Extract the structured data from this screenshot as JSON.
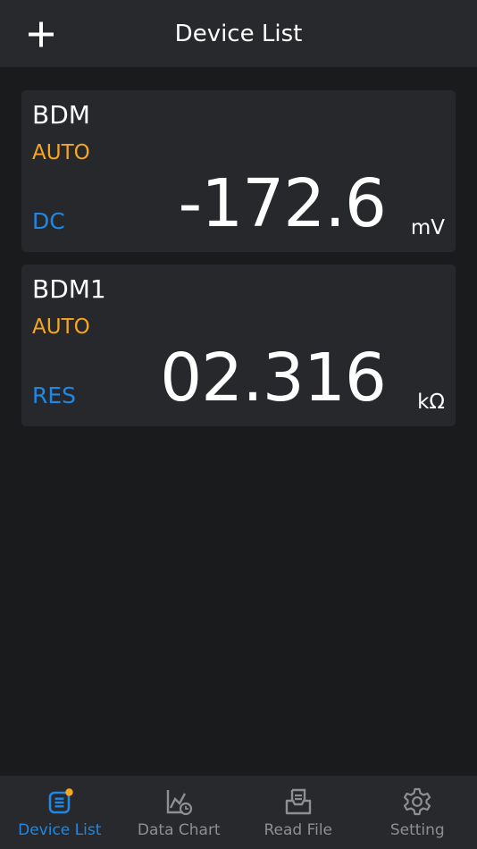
{
  "header": {
    "title": "Device List",
    "add_icon": "plus-icon"
  },
  "colors": {
    "range": "#f5a623",
    "mode": "#1e88e5",
    "tab_active": "#1e88e5",
    "tab_inactive": "#8e8f91"
  },
  "devices": [
    {
      "name": "BDM",
      "range": "AUTO",
      "mode": "DC",
      "reading": "-172.6",
      "unit": "mV"
    },
    {
      "name": "BDM1",
      "range": "AUTO",
      "mode": "RES",
      "reading": "02.316",
      "unit": "kΩ"
    }
  ],
  "tabs": [
    {
      "label": "Device List",
      "icon": "device-list-icon",
      "active": true
    },
    {
      "label": "Data Chart",
      "icon": "data-chart-icon",
      "active": false
    },
    {
      "label": "Read File",
      "icon": "read-file-icon",
      "active": false
    },
    {
      "label": "Setting",
      "icon": "gear-icon",
      "active": false
    }
  ]
}
